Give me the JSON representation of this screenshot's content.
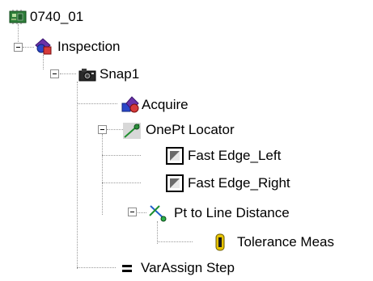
{
  "tree": {
    "root": {
      "label": "0740_01",
      "icon": "circuit-board-icon"
    },
    "inspection": {
      "label": "Inspection",
      "icon": "inspection-shapes-icon"
    },
    "snap": {
      "label": "Snap1",
      "icon": "camera-icon"
    },
    "acquire": {
      "label": "Acquire",
      "icon": "acquire-shapes-icon"
    },
    "locator": {
      "label": "OnePt Locator",
      "icon": "locator-icon"
    },
    "edge_left": {
      "label": "Fast Edge_Left",
      "icon": "edge-tool-icon"
    },
    "edge_right": {
      "label": "Fast Edge_Right",
      "icon": "edge-tool-icon"
    },
    "distance": {
      "label": "Pt to Line Distance",
      "icon": "distance-icon"
    },
    "tolerance": {
      "label": "Tolerance Meas",
      "icon": "tolerance-icon"
    },
    "varassign": {
      "label": "VarAssign Step",
      "icon": "equals-icon"
    }
  },
  "colors": {
    "board_green": "#2f7f3a",
    "inspection_purple": "#6a32a8",
    "acquire_blue": "#2b47c9",
    "locator_green": "#1f8f2f",
    "tolerance_yellow": "#e6c200"
  }
}
